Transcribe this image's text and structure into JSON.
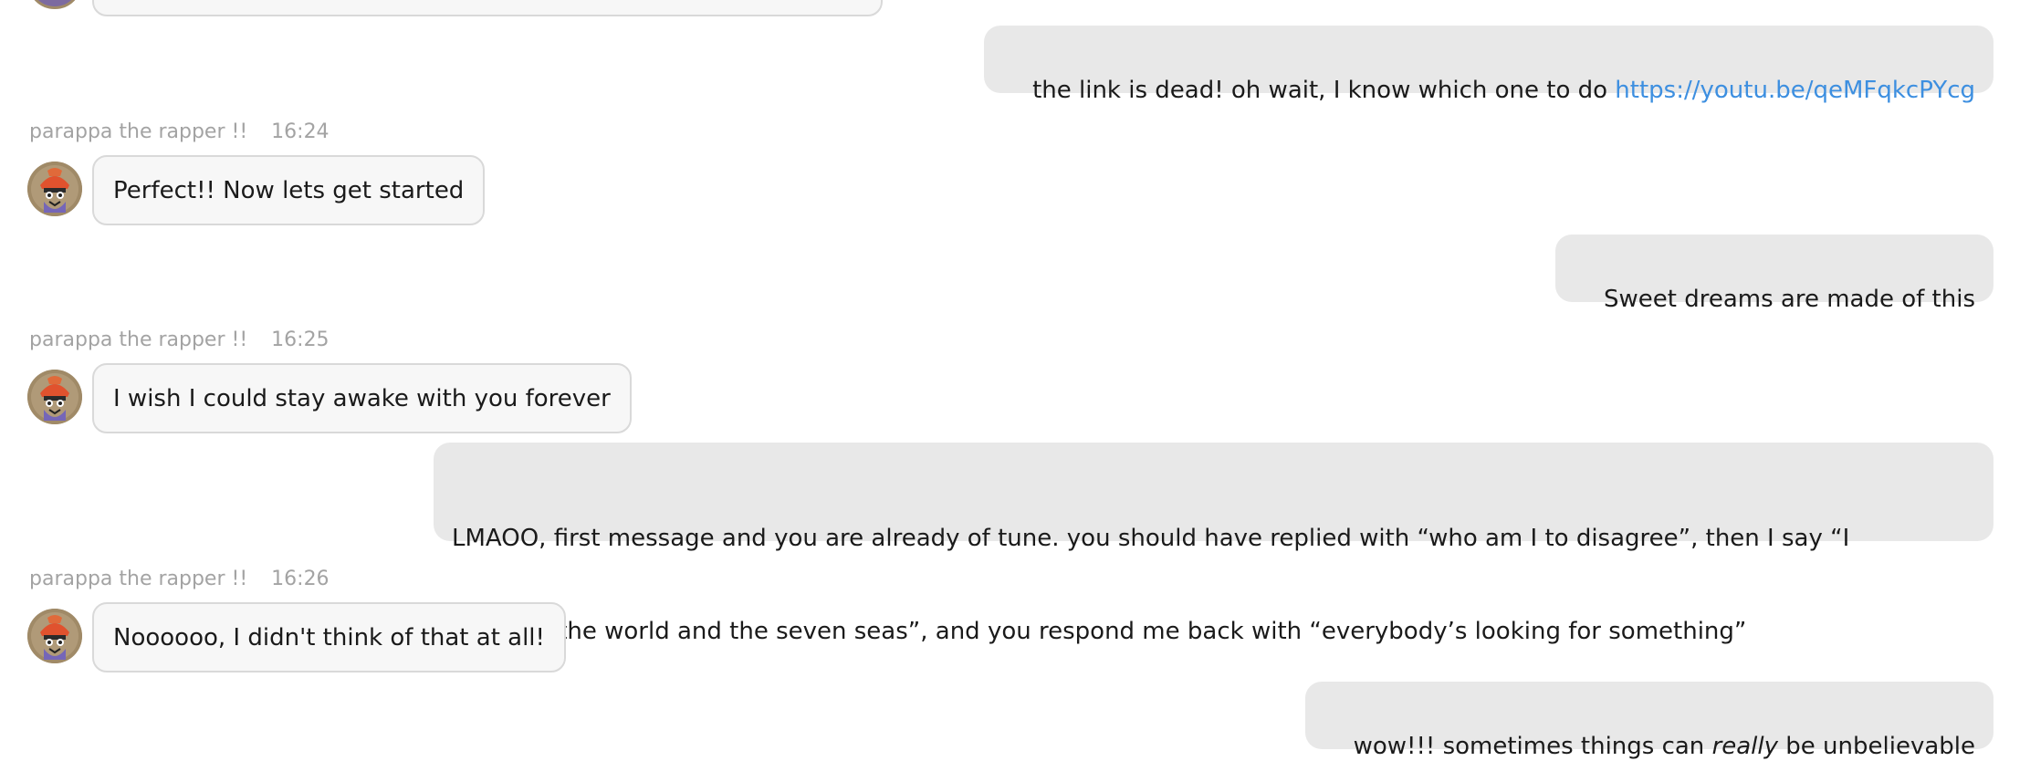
{
  "bot_name": "parappa the rapper !!",
  "messages": [
    {
      "sender": "user",
      "text": "the link is dead! oh wait, I know which one to do ",
      "link": "https://youtu.be/qeMFqkcPYcg"
    },
    {
      "sender": "bot",
      "time": "16:24",
      "text": "Perfect!! Now lets get started"
    },
    {
      "sender": "user",
      "text": "Sweet dreams are made of this"
    },
    {
      "sender": "bot",
      "time": "16:25",
      "text": "I wish I could stay awake with you forever"
    },
    {
      "sender": "user",
      "text_line1": "LMAOO, first message and you are already of tune. you should have replied with “who am I to disagree”, then I say “I",
      "text_line2": "traveled the world and the seven seas”, and you respond me back with “everybody’s looking for something”"
    },
    {
      "sender": "bot",
      "time": "16:26",
      "text": "Noooooo, I didn't think of that at all!"
    },
    {
      "sender": "user",
      "text_before": "wow!!! sometimes things can ",
      "text_emphasis": "really",
      "text_after": " be unbelievable"
    }
  ],
  "colors": {
    "user_bubble": "#e8e8e8",
    "bot_bubble": "#f7f7f7",
    "link": "#3d8fe0",
    "meta_text": "#a3a3a3"
  },
  "icons": {
    "bot_avatar": "parappa-avatar-icon"
  }
}
